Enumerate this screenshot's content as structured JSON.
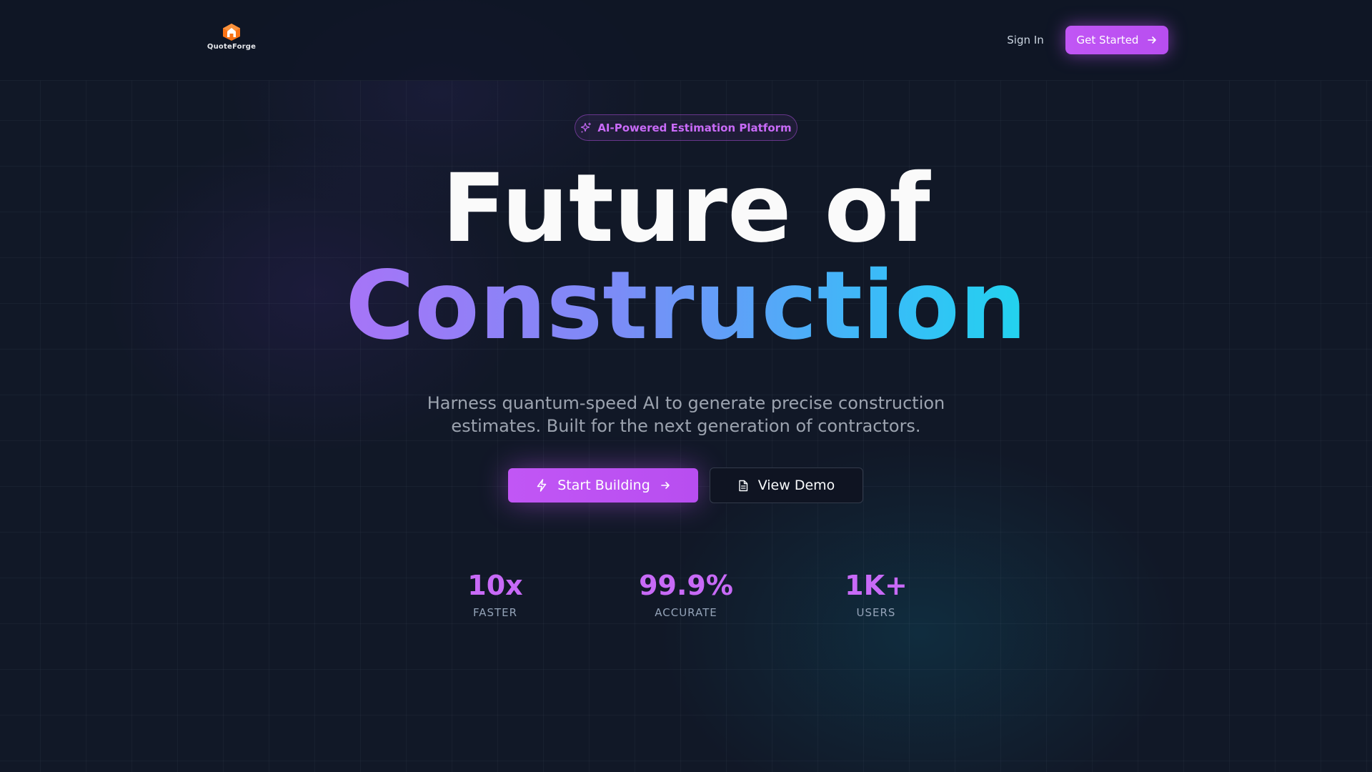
{
  "header": {
    "brand": "QuoteForge",
    "sign_in": "Sign In",
    "get_started": "Get Started"
  },
  "hero": {
    "badge": "AI-Powered Estimation Platform",
    "title_line1": "Future of",
    "title_line2": "Construction",
    "subtitle": "Harness quantum-speed AI to generate precise construction estimates. Built for the next generation of contractors.",
    "primary_cta": "Start Building",
    "secondary_cta": "View Demo"
  },
  "stats": [
    {
      "value": "10x",
      "label": "FASTER"
    },
    {
      "value": "99.9%",
      "label": "ACCURATE"
    },
    {
      "value": "1K+",
      "label": "USERS"
    }
  ],
  "icons": {
    "logo": "house-hexagon-icon",
    "arrow": "arrow-right-icon",
    "badge": "sparkles-icon",
    "start": "lightning-icon",
    "demo": "document-icon"
  },
  "colors": {
    "background": "#111827",
    "accent": "#c156f5",
    "gradient_start": "#a774f7",
    "gradient_end": "#22d3ee"
  }
}
